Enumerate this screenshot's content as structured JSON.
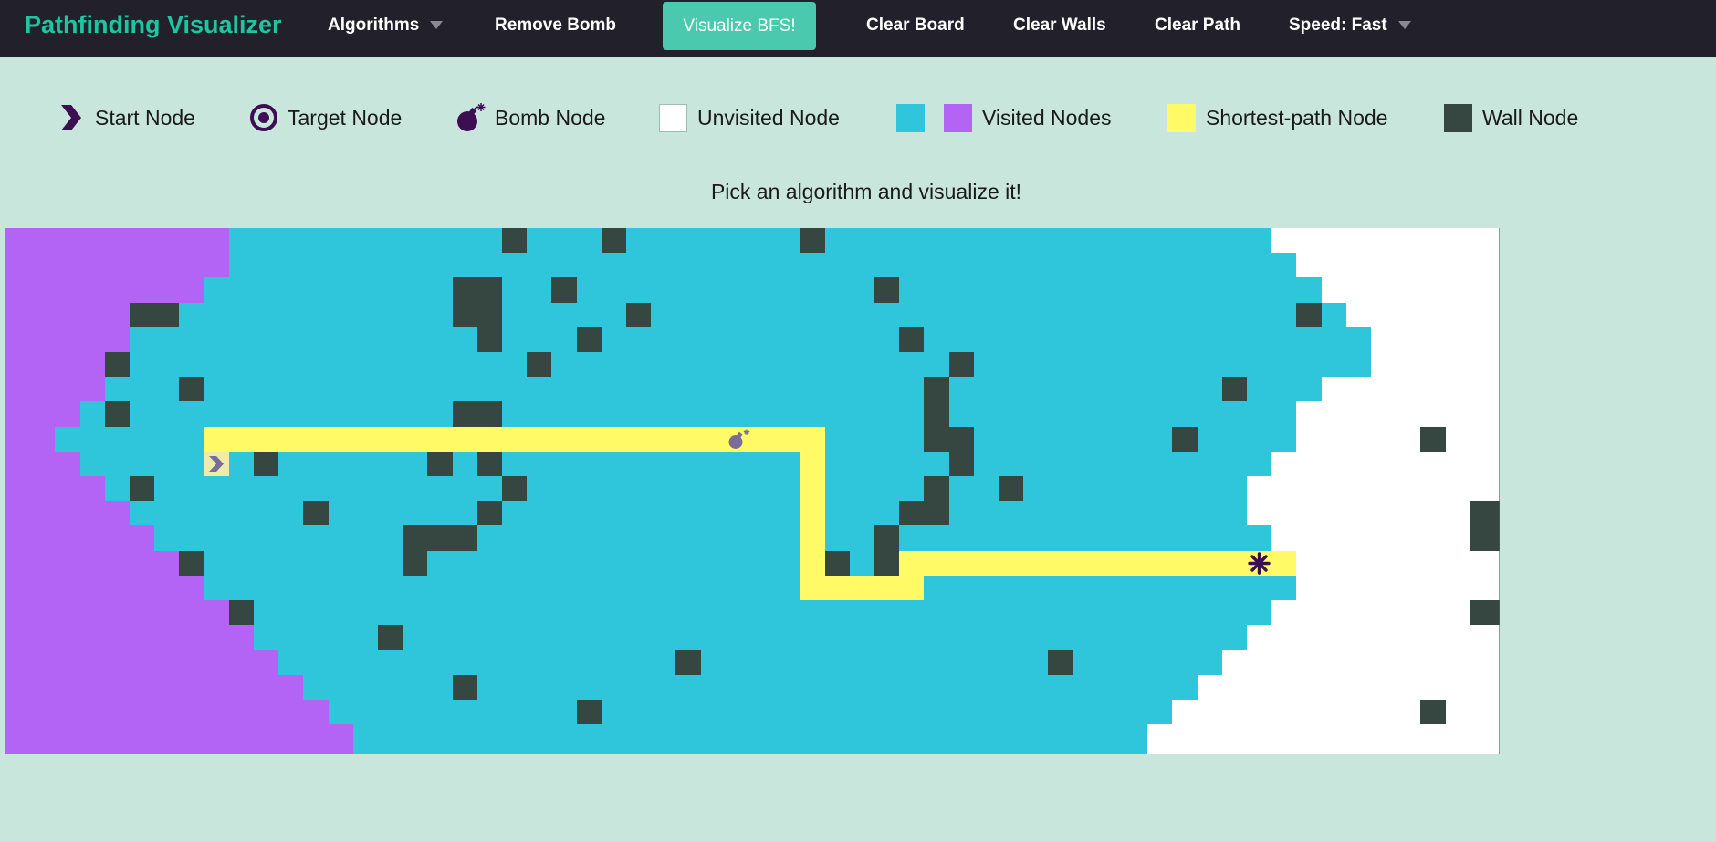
{
  "app": {
    "title": "Pathfinding Visualizer"
  },
  "navbar": {
    "algorithms_label": "Algorithms",
    "remove_bomb_label": "Remove Bomb",
    "visualize_label": "Visualize BFS!",
    "clear_board_label": "Clear Board",
    "clear_walls_label": "Clear Walls",
    "clear_path_label": "Clear Path",
    "speed_label": "Speed: Fast"
  },
  "legend": {
    "start_label": "Start Node",
    "target_label": "Target Node",
    "bomb_label": "Bomb Node",
    "unvisited_label": "Unvisited Node",
    "visited_label": "Visited Nodes",
    "shortest_label": "Shortest-path Node",
    "wall_label": "Wall Node"
  },
  "status": {
    "message": "Pick an algorithm and visualize it!"
  },
  "icons": {
    "start": "chevron-right-icon",
    "target": "target-icon",
    "bomb": "bomb-icon"
  },
  "colors": {
    "brand": "#1fc4a1",
    "navbar": "#22212b",
    "visualize_button": "#4bc9ae",
    "background": "#c8e6dc",
    "unvisited": "#ffffff",
    "visited_primary": "#2fc6dc",
    "visited_secondary": "#b464f5",
    "shortest_path": "#fffa66",
    "wall": "#354740",
    "node_icon": "#3d0f52"
  },
  "board": {
    "rows": [
      "PPPPPPPPPCCCCCCCCCCCWCCCWCCCCCCCWCCCCCCCCCCCCCCCCCCUUUUUUUUU",
      "PPPPPPPPPCCCCCCCCCCCCCCCCCCCCCCCCCCCCCCCCCCCCCCCCCCCUUUUUUUU",
      "PPPPPPPPCCCCCCCCCCWWCCWCCCCCCCCCCCCWCCCCCCCCCCCCCCCCCUUUUUUU",
      "PPPPPWWCCCCCCCCCCCWWCCCCCWCCCCCCCCCCCCCCCCCCCCCCCCCCWCUUUUUU",
      "PPPPPCCCCCCCCCCCCCCWCCCWCCCCCCCCCCCCWCCCCCCCCCCCCCCCCCCUUUUU",
      "PPPPWCCCCCCCCCCCCCCCCWCCCCCCCCCCCCCCCCWCCCCCCCCCCCCCCCCUUUUU",
      "PPPPCCCWCCCCCCCCCCCCCCCCCCCCCCCCCCCCCWCCCCCCCCCCCWCCCUUUUUUU",
      "PPPCWCCCCCCCCCCCCCWWCCCCCCCCCCCCCCCCCWCCCCCCCCCCCCCCUUUUUUUU",
      "PPCCCCCCYYYYYYYYYYYYYYYYYYYYYYYYYCCCCWWCCCCCCCCWCCCCUUUUUWUU",
      "PPPCCCCCSCWCCCCCCWCWCCCCCCCCCCCCYCCCCCWCCCCCCCCCCCCUUUUUUUUU",
      "PPPPCWCCCCCCCCCCCCCCWCCCCCCCCCCCYCCCCWCCWCCCCCCCCCUUUUUUUUUU",
      "PPPPPCCCCCCCWCCCCCCWCCCCCCCCCCCCYCCCWWCCCCCCCCCCCCUUUUUUUUUW",
      "PPPPPPCCCCCCCCCCWWWCCCCCCCCCCCCCYCCWCCCCCCCCCCCCCCCUUUUUUUUW",
      "PPPPPPPWCCCCCCCCWCCCCCCCCCCCCCCCYWCWYYYYYYYYYYYYYYYYUUUUUUUU",
      "PPPPPPPPCCCCCCCCCCCCCCCCCCCCCCCCYYYYYCCCCCCCCCCCCCCCUUUUUUUU",
      "PPPPPPPPPWCCCCCCCCCCCCCCCCCCCCCCCCCCCCCCCCCCCCCCCCCUUUUUUUUW",
      "PPPPPPPPPPCCCCCWCCCCCCCCCCCCCCCCCCCCCCCCCCCCCCCCCCUUUUUUUUUU",
      "PPPPPPPPPPPCCCCCCCCCCCCCCCCWCCCCCCCCCCCCCCWCCCCCCUUUUUUUUUUU",
      "PPPPPPPPPPPPCCCCCCWCCCCCCCCCCCCCCCCCCCCCCCCCCCCCUUUUUUUUUUUU",
      "PPPPPPPPPPPPPCCCCCCCCCCWCCCCCCCCCCCCCCCCCCCCCCCUUUUUUUUUUWUU",
      "PPPPPPPPPPPPPPCCCCCCCCCCCCCCCCCCCCCCCCCCCCCCCCUUUUUUUUUUUUUU"
    ],
    "start": {
      "row": 9,
      "col": 8
    },
    "target": {
      "row": 13,
      "col": 50
    },
    "bomb": {
      "row": 8,
      "col": 29
    }
  }
}
